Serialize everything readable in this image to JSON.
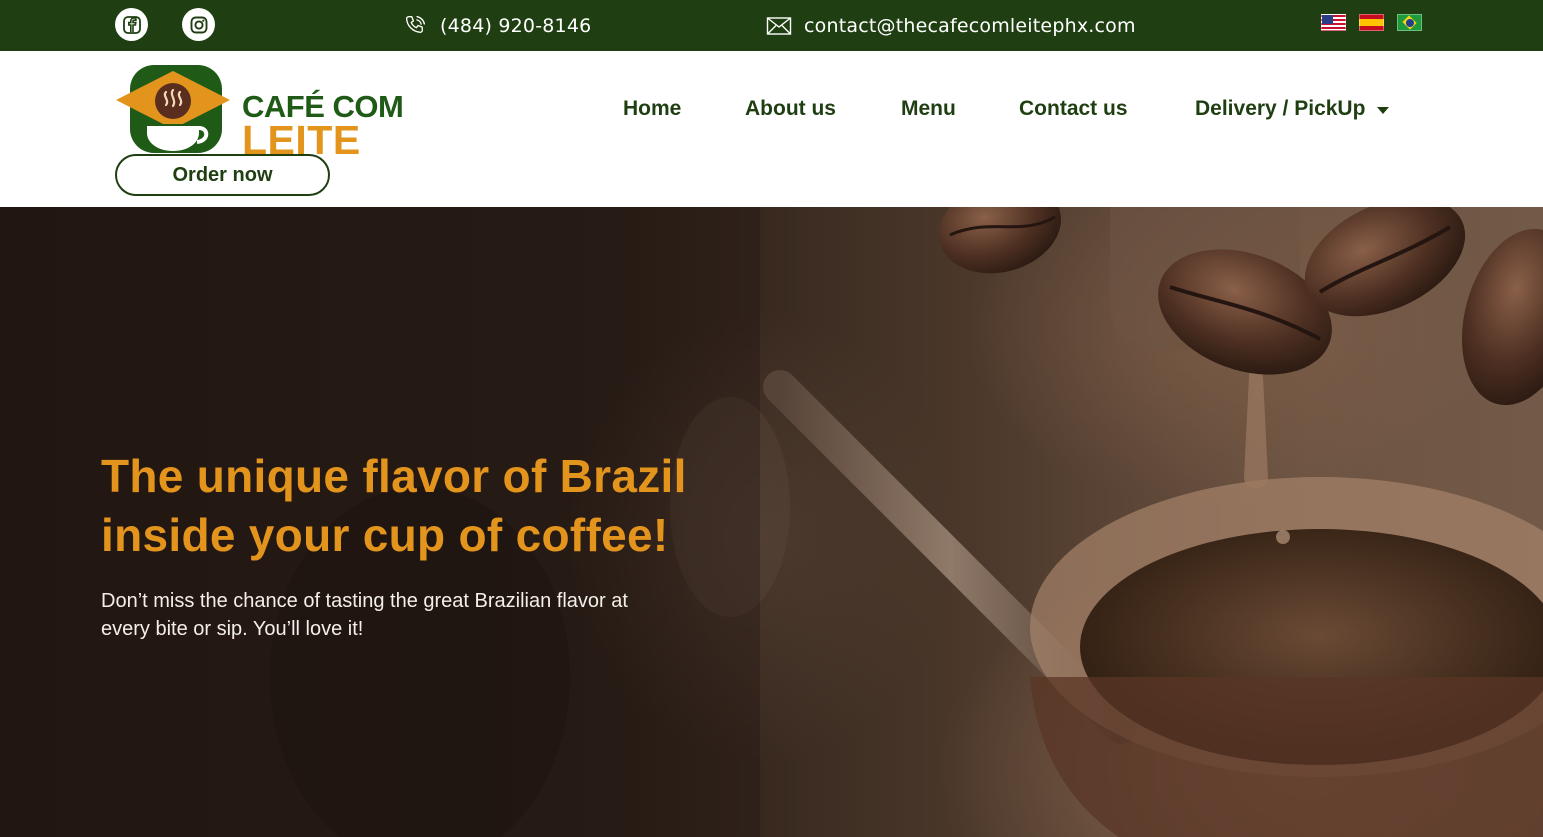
{
  "topbar": {
    "social": [
      {
        "icon": "facebook-icon"
      },
      {
        "icon": "instagram-icon"
      }
    ],
    "phone": {
      "icon": "phone-icon",
      "text": "(484) 920-8146"
    },
    "email": {
      "icon": "mail-icon",
      "text": "contact@thecafecomleitephx.com"
    },
    "languages": [
      {
        "icon": "us-flag-icon"
      },
      {
        "icon": "spain-flag-icon"
      },
      {
        "icon": "brazil-flag-icon"
      }
    ],
    "background_color": "#1f3f12"
  },
  "header": {
    "logo": {
      "line1": "CAFÉ COM",
      "line2": "LEITE"
    },
    "order_button": "Order now",
    "nav": {
      "home": "Home",
      "about": "About us",
      "menu": "Menu",
      "contact": "Contact us",
      "delivery": "Delivery / PickUp"
    }
  },
  "hero": {
    "title": "The unique flavor of Brazil inside your cup of coffee!",
    "subtitle": "Don’t miss the chance of tasting the great Brazilian flavor at every bite or sip. You’ll love it!"
  },
  "colors": {
    "brand_green": "#1f3f12",
    "brand_orange": "#e3941d",
    "logo_green": "#1f5b17"
  }
}
